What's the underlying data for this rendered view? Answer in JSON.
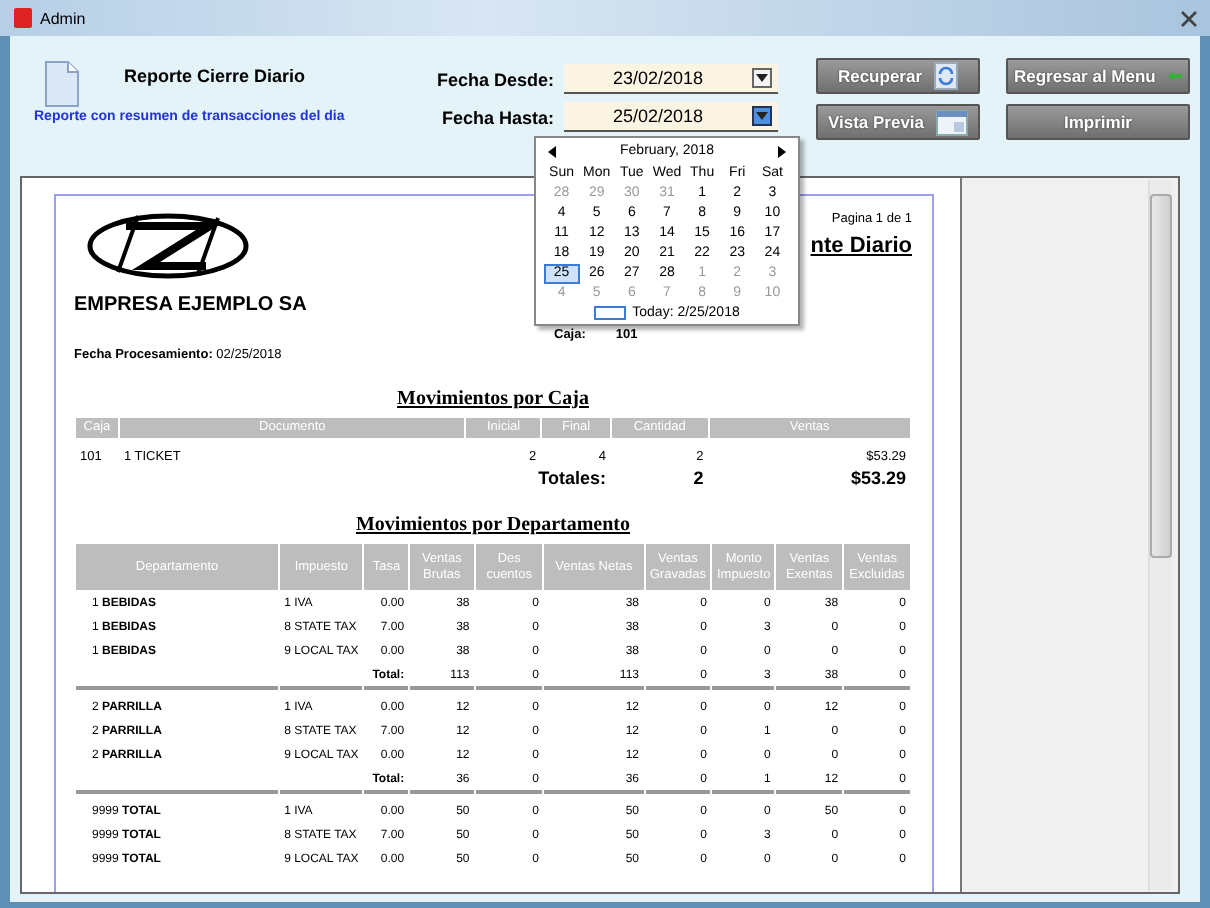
{
  "window": {
    "title": "Admin"
  },
  "report_info": {
    "title": "Reporte Cierre Diario",
    "description": "Reporte con resumen de transacciones del dia"
  },
  "filters": [
    {
      "label": "Fecha Desde:",
      "value": "23/02/2018",
      "open": false
    },
    {
      "label": "Fecha Hasta:",
      "value": "25/02/2018",
      "open": true
    }
  ],
  "buttons": [
    {
      "label": "Recuperar",
      "kind": "refresh"
    },
    {
      "label": "Regresar al Menu",
      "kind": "back"
    },
    {
      "label": "Vista Previa",
      "kind": "preview"
    },
    {
      "label": "Imprimir",
      "kind": "plain"
    }
  ],
  "calendar": {
    "month": "February, 2018",
    "weekdays": [
      "Sun",
      "Mon",
      "Tue",
      "Wed",
      "Thu",
      "Fri",
      "Sat"
    ],
    "days": [
      {
        "label": "28",
        "other_month": true,
        "selected": false
      },
      {
        "label": "29",
        "other_month": true,
        "selected": false
      },
      {
        "label": "30",
        "other_month": true,
        "selected": false
      },
      {
        "label": "31",
        "other_month": true,
        "selected": false
      },
      {
        "label": "1",
        "other_month": false,
        "selected": false
      },
      {
        "label": "2",
        "other_month": false,
        "selected": false
      },
      {
        "label": "3",
        "other_month": false,
        "selected": false
      },
      {
        "label": "4",
        "other_month": false,
        "selected": false
      },
      {
        "label": "5",
        "other_month": false,
        "selected": false
      },
      {
        "label": "6",
        "other_month": false,
        "selected": false
      },
      {
        "label": "7",
        "other_month": false,
        "selected": false
      },
      {
        "label": "8",
        "other_month": false,
        "selected": false
      },
      {
        "label": "9",
        "other_month": false,
        "selected": false
      },
      {
        "label": "10",
        "other_month": false,
        "selected": false
      },
      {
        "label": "11",
        "other_month": false,
        "selected": false
      },
      {
        "label": "12",
        "other_month": false,
        "selected": false
      },
      {
        "label": "13",
        "other_month": false,
        "selected": false
      },
      {
        "label": "14",
        "other_month": false,
        "selected": false
      },
      {
        "label": "15",
        "other_month": false,
        "selected": false
      },
      {
        "label": "16",
        "other_month": false,
        "selected": false
      },
      {
        "label": "17",
        "other_month": false,
        "selected": false
      },
      {
        "label": "18",
        "other_month": false,
        "selected": false
      },
      {
        "label": "19",
        "other_month": false,
        "selected": false
      },
      {
        "label": "20",
        "other_month": false,
        "selected": false
      },
      {
        "label": "21",
        "other_month": false,
        "selected": false
      },
      {
        "label": "22",
        "other_month": false,
        "selected": false
      },
      {
        "label": "23",
        "other_month": false,
        "selected": false
      },
      {
        "label": "24",
        "other_month": false,
        "selected": false
      },
      {
        "label": "25",
        "other_month": false,
        "selected": true
      },
      {
        "label": "26",
        "other_month": false,
        "selected": false
      },
      {
        "label": "27",
        "other_month": false,
        "selected": false
      },
      {
        "label": "28",
        "other_month": false,
        "selected": false
      },
      {
        "label": "1",
        "other_month": true,
        "selected": false
      },
      {
        "label": "2",
        "other_month": true,
        "selected": false
      },
      {
        "label": "3",
        "other_month": true,
        "selected": false
      },
      {
        "label": "4",
        "other_month": true,
        "selected": false
      },
      {
        "label": "5",
        "other_month": true,
        "selected": false
      },
      {
        "label": "6",
        "other_month": true,
        "selected": false
      },
      {
        "label": "7",
        "other_month": true,
        "selected": false
      },
      {
        "label": "8",
        "other_month": true,
        "selected": false
      },
      {
        "label": "9",
        "other_month": true,
        "selected": false
      },
      {
        "label": "10",
        "other_month": true,
        "selected": false
      }
    ],
    "today": "Today: 2/25/2018"
  },
  "report": {
    "page": "Pagina 1 de 1",
    "title": "nte Diario",
    "company": "EMPRESA EJEMPLO SA",
    "caja_label": "Caja:",
    "caja_value": "101",
    "processing_date": "**Fecha Procesamiento:** 02/25/2018",
    "caja_section": {
      "title": "Movimientos por Caja",
      "columns": [
        "Caja",
        "Documento",
        "Inicial",
        "Final",
        "Cantidad",
        "Ventas"
      ],
      "rows": [
        [
          "101",
          "1  TICKET",
          "2",
          "4",
          "2",
          "$53.29"
        ]
      ],
      "totals_label": "Totales:",
      "totals": [
        "2",
        "$53.29"
      ]
    },
    "department_section": {
      "title": "Movimientos por Departamento",
      "columns": [
        "Departamento",
        "Impuesto",
        "Tasa",
        "Ventas Brutas",
        "Des cuentos",
        "Ventas Netas",
        "Ventas Gravadas",
        "Monto Impuesto",
        "Ventas Exentas",
        "Ventas Excluidas"
      ],
      "groups": [
        {
          "rows": [
            {
              "department": "1 **BEBIDAS**",
              "cells": [
                "1 IVA",
                "0.00",
                "38",
                "0",
                "38",
                "0",
                "0",
                "38",
                "0"
              ]
            },
            {
              "department": "1 **BEBIDAS**",
              "cells": [
                "8 STATE TAX",
                "7.00",
                "38",
                "0",
                "38",
                "0",
                "3",
                "0",
                "0"
              ]
            },
            {
              "department": "1 **BEBIDAS**",
              "cells": [
                "9 LOCAL TAX",
                "0.00",
                "38",
                "0",
                "38",
                "0",
                "0",
                "0",
                "0"
              ]
            }
          ],
          "total_label": "Total:",
          "total": [
            "113",
            "0",
            "113",
            "0",
            "3",
            "38",
            "0"
          ]
        },
        {
          "rows": [
            {
              "department": "2 **PARRILLA**",
              "cells": [
                "1 IVA",
                "0.00",
                "12",
                "0",
                "12",
                "0",
                "0",
                "12",
                "0"
              ]
            },
            {
              "department": "2 **PARRILLA**",
              "cells": [
                "8 STATE TAX",
                "7.00",
                "12",
                "0",
                "12",
                "0",
                "1",
                "0",
                "0"
              ]
            },
            {
              "department": "2 **PARRILLA**",
              "cells": [
                "9 LOCAL TAX",
                "0.00",
                "12",
                "0",
                "12",
                "0",
                "0",
                "0",
                "0"
              ]
            }
          ],
          "total_label": "Total:",
          "total": [
            "36",
            "0",
            "36",
            "0",
            "1",
            "12",
            "0"
          ]
        },
        {
          "rows": [
            {
              "department": "9999 **TOTAL**",
              "cells": [
                "1 IVA",
                "0.00",
                "50",
                "0",
                "50",
                "0",
                "0",
                "50",
                "0"
              ]
            },
            {
              "department": "9999 **TOTAL**",
              "cells": [
                "8 STATE TAX",
                "7.00",
                "50",
                "0",
                "50",
                "0",
                "3",
                "0",
                "0"
              ]
            },
            {
              "department": "9999 **TOTAL**",
              "cells": [
                "9 LOCAL TAX",
                "0.00",
                "50",
                "0",
                "50",
                "0",
                "0",
                "0",
                "0"
              ]
            }
          ]
        }
      ]
    }
  }
}
